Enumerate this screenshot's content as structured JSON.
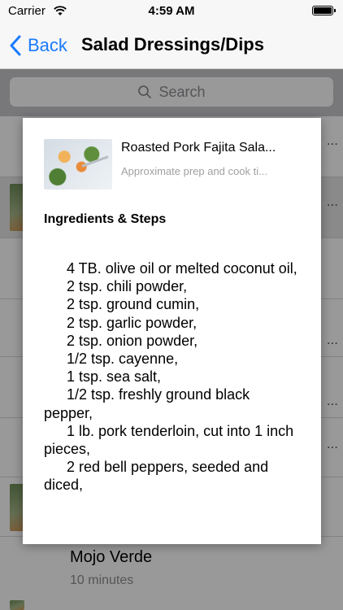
{
  "status": {
    "carrier": "Carrier",
    "time": "4:59 AM"
  },
  "nav": {
    "back_label": "Back",
    "title": "Salad Dressings/Dips"
  },
  "search": {
    "placeholder": "Search"
  },
  "list_peek": [
    "...",
    "...",
    "...",
    "...",
    "...",
    "..."
  ],
  "list_bottom": {
    "title": "Mojo Verde",
    "subtitle": "10 minutes"
  },
  "popup": {
    "recipe_title": "Roasted Pork Fajita Sala...",
    "recipe_subtitle": "Approximate prep and cook ti...",
    "section_heading": "Ingredients & Steps",
    "steps": [
      "4 TB. olive oil or melted coconut oil,",
      "2 tsp. chili powder,",
      "2 tsp. ground cumin,",
      "2 tsp. garlic powder,",
      "2 tsp. onion powder,",
      "1/2 tsp. cayenne,",
      "1 tsp. sea salt,",
      "1/2 tsp. freshly ground black pepper,",
      "1 lb. pork tenderloin, cut into 1 inch pieces,",
      "2 red bell peppers, seeded and diced,"
    ]
  }
}
